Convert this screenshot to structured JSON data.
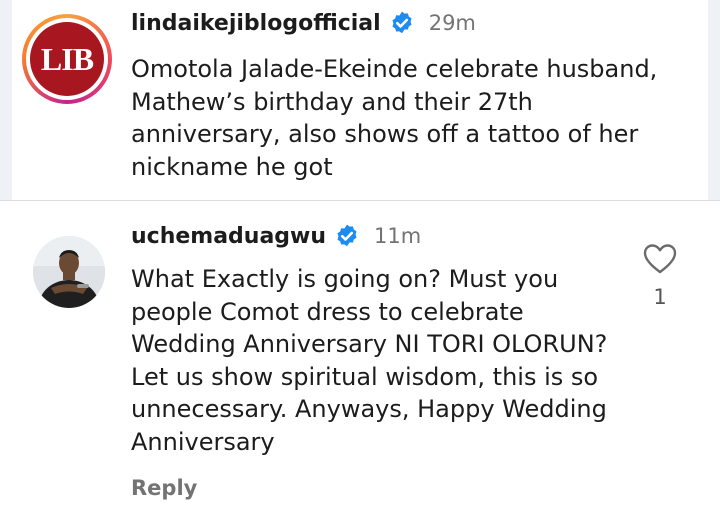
{
  "post": {
    "username": "lindaikejiblogofficial",
    "time": "29m",
    "avatar_text": "LIB",
    "caption": "Omotola Jalade-Ekeinde celebrate husband, Mathew’s birthday and their 27th anniversary, also shows off a tattoo of her nickname he got"
  },
  "comment": {
    "username": "uchemaduagwu",
    "time": "11m",
    "text": "What Exactly is going on? Must you people Comot dress to celebrate Wedding Anniversary NI TORI OLORUN? Let us show spiritual wisdom, this is so unnecessary. Anyways, Happy Wedding Anniversary",
    "like_count": "1",
    "reply_label": "Reply"
  },
  "icons": {
    "verified": "verified-badge-icon",
    "like": "heart-icon"
  },
  "colors": {
    "verified_blue": "#1d8cf0",
    "lib_red": "#a8171f",
    "muted_text": "#737373"
  }
}
